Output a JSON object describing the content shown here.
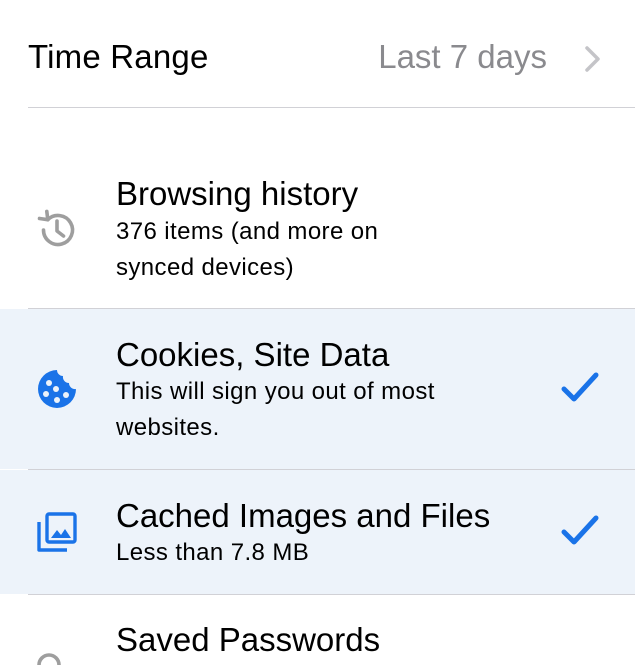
{
  "time_range": {
    "title": "Time Range",
    "value": "Last 7 days"
  },
  "items": [
    {
      "title": "Browsing history",
      "subtitle": "376 items (and more on synced devices)",
      "icon": "history-icon",
      "selected": false
    },
    {
      "title": "Cookies, Site Data",
      "subtitle": "This will sign you out of most websites.",
      "icon": "cookie-icon",
      "selected": true
    },
    {
      "title": "Cached Images and Files",
      "subtitle": "Less than 7.8 MB",
      "icon": "image-stack-icon",
      "selected": true
    },
    {
      "title": "Saved Passwords",
      "subtitle": "",
      "icon": "key-icon",
      "selected": false
    }
  ],
  "colors": {
    "accent": "#1a73e8",
    "selected_bg": "#edf3fa",
    "secondary_text": "#8a8a8e",
    "divider": "#d1d1d6",
    "icon_gray": "#9e9e9e"
  }
}
